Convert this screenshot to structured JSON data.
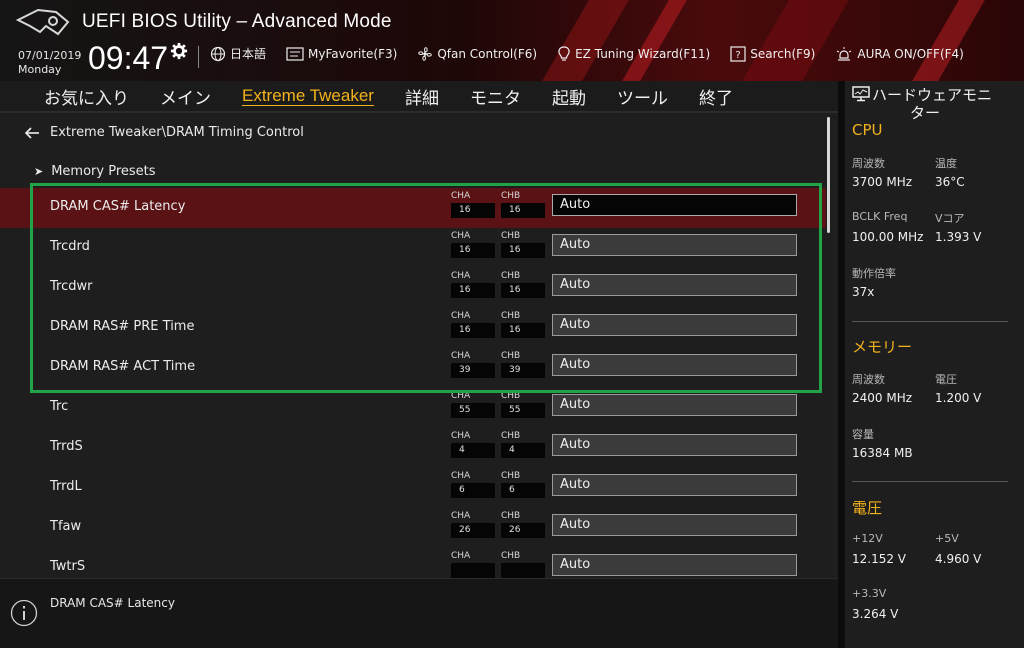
{
  "header": {
    "title": "UEFI BIOS Utility – Advanced Mode",
    "date": "07/01/2019",
    "day": "Monday",
    "time": "09:47",
    "toolbar": [
      {
        "label": "日本語",
        "icon": "globe-icon"
      },
      {
        "label": "MyFavorite(F3)",
        "icon": "favorite-icon"
      },
      {
        "label": "Qfan Control(F6)",
        "icon": "fan-icon"
      },
      {
        "label": "EZ Tuning Wizard(F11)",
        "icon": "bulb-icon"
      },
      {
        "label": "Search(F9)",
        "icon": "search-icon"
      },
      {
        "label": "AURA ON/OFF(F4)",
        "icon": "aura-icon"
      }
    ]
  },
  "nav": {
    "tabs": [
      "お気に入り",
      "メイン",
      "Extreme Tweaker",
      "詳細",
      "モニタ",
      "起動",
      "ツール",
      "終了"
    ],
    "active": "Extreme Tweaker"
  },
  "main": {
    "breadcrumb": "Extreme Tweaker\\DRAM Timing Control",
    "presets": "Memory Presets",
    "ch_a_label": "CHA",
    "ch_b_label": "CHB",
    "rows": [
      {
        "label": "DRAM CAS# Latency",
        "cha": "16",
        "chb": "16",
        "value": "Auto"
      },
      {
        "label": "Trcdrd",
        "cha": "16",
        "chb": "16",
        "value": "Auto"
      },
      {
        "label": "Trcdwr",
        "cha": "16",
        "chb": "16",
        "value": "Auto"
      },
      {
        "label": "DRAM RAS# PRE Time",
        "cha": "16",
        "chb": "16",
        "value": "Auto"
      },
      {
        "label": "DRAM RAS# ACT Time",
        "cha": "39",
        "chb": "39",
        "value": "Auto"
      },
      {
        "label": "Trc",
        "cha": "55",
        "chb": "55",
        "value": "Auto"
      },
      {
        "label": "TrrdS",
        "cha": "4",
        "chb": "4",
        "value": "Auto"
      },
      {
        "label": "TrrdL",
        "cha": "6",
        "chb": "6",
        "value": "Auto"
      },
      {
        "label": "Tfaw",
        "cha": "26",
        "chb": "26",
        "value": "Auto"
      },
      {
        "label": "TwtrS",
        "cha": "",
        "chb": "",
        "value": "Auto"
      }
    ]
  },
  "help": {
    "text": "DRAM CAS# Latency"
  },
  "monitor": {
    "title_line1": "ハードウェアモニ",
    "title_line2": "ター",
    "cpu": {
      "section": "CPU",
      "freq_label": "周波数",
      "freq": "3700 MHz",
      "temp_label": "温度",
      "temp": "36°C",
      "bclk_label": "BCLK Freq",
      "bclk": "100.00 MHz",
      "vcore_label": "Vコア",
      "vcore": "1.393 V",
      "ratio_label": "動作倍率",
      "ratio": "37x"
    },
    "memory": {
      "section": "メモリー",
      "freq_label": "周波数",
      "freq": "2400 MHz",
      "volt_label": "電圧",
      "volt": "1.200 V",
      "cap_label": "容量",
      "cap": "16384 MB"
    },
    "voltage": {
      "section": "電圧",
      "v12_label": "+12V",
      "v12": "12.152 V",
      "v5_label": "+5V",
      "v5": "4.960 V",
      "v33_label": "+3.3V",
      "v33": "3.264 V"
    }
  }
}
